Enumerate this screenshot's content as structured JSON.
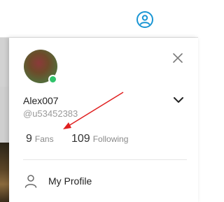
{
  "header": {
    "profile_icon": "user-circle-icon",
    "accent_color": "#1a96d4"
  },
  "profile_panel": {
    "close_icon": "close-icon",
    "online_status_color": "#2fc36a",
    "username": "Alex007",
    "handle": "@u53452383",
    "expand_icon": "chevron-down-icon",
    "stats": {
      "fans_count": "9",
      "fans_label": "Fans",
      "following_count": "109",
      "following_label": "Following"
    },
    "menu": [
      {
        "icon": "person-icon",
        "label": "My Profile"
      }
    ]
  },
  "annotation": {
    "arrow_color": "#e02020"
  }
}
